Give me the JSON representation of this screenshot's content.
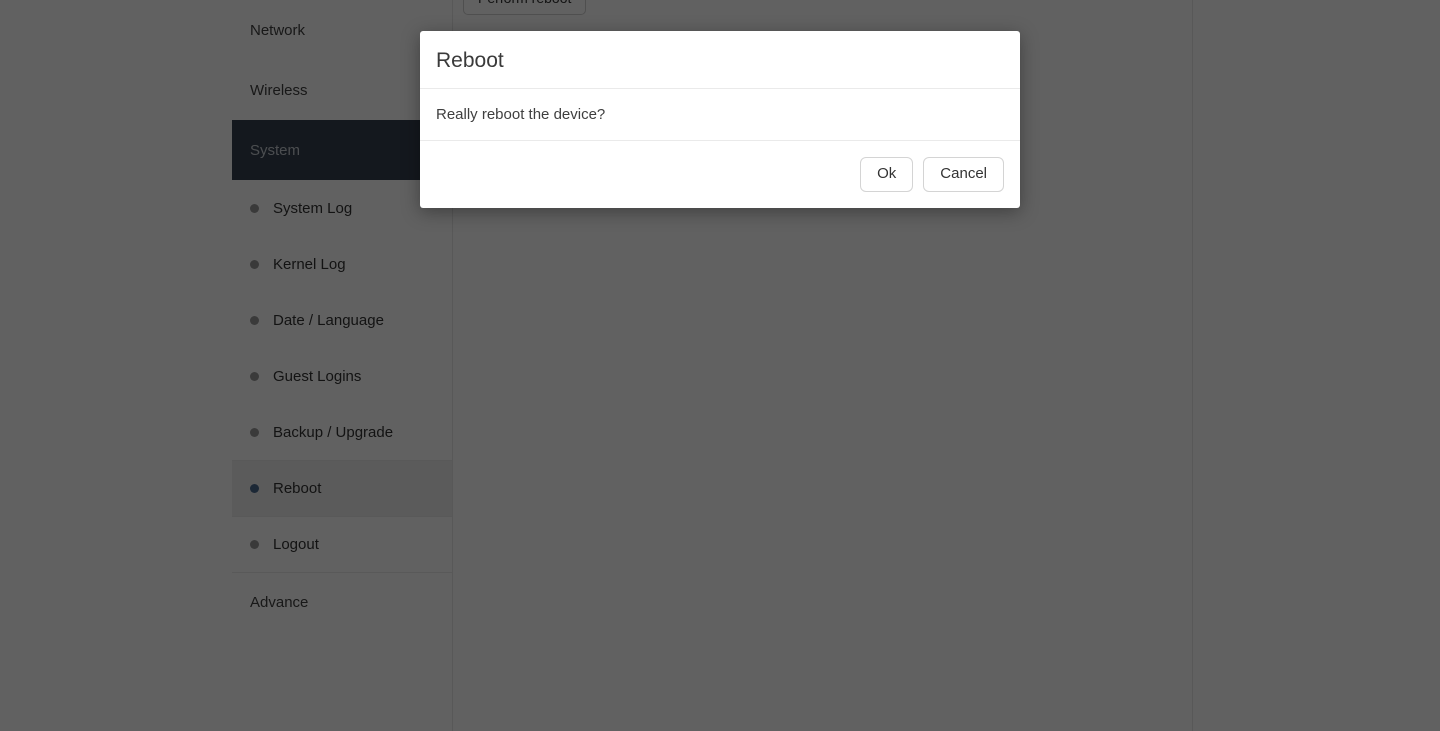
{
  "sidebar": {
    "items": [
      {
        "label": "Network",
        "kind": "top",
        "state": "normal"
      },
      {
        "label": "Wireless",
        "kind": "top",
        "state": "normal"
      },
      {
        "label": "System",
        "kind": "top",
        "state": "active-parent"
      },
      {
        "label": "System Log",
        "kind": "sub",
        "state": "normal"
      },
      {
        "label": "Kernel Log",
        "kind": "sub",
        "state": "normal"
      },
      {
        "label": "Date / Language",
        "kind": "sub",
        "state": "normal"
      },
      {
        "label": "Guest Logins",
        "kind": "sub",
        "state": "normal"
      },
      {
        "label": "Backup / Upgrade",
        "kind": "sub",
        "state": "normal"
      },
      {
        "label": "Reboot",
        "kind": "sub",
        "state": "active"
      },
      {
        "label": "Logout",
        "kind": "sub",
        "state": "normal"
      },
      {
        "label": "Advance",
        "kind": "top",
        "state": "normal"
      }
    ]
  },
  "main": {
    "perform_reboot_label": "Perform reboot"
  },
  "modal": {
    "title": "Reboot",
    "message": "Really reboot the device?",
    "ok_label": "Ok",
    "cancel_label": "Cancel"
  },
  "colors": {
    "overlay": "#000000",
    "active_parent_bg": "#35414f",
    "active_sub_bg": "#eeeeee",
    "active_bullet": "#4a6a8f",
    "bullet": "#9a9a9a",
    "page_bg": "#ffffff",
    "border": "#e6e6e6"
  }
}
